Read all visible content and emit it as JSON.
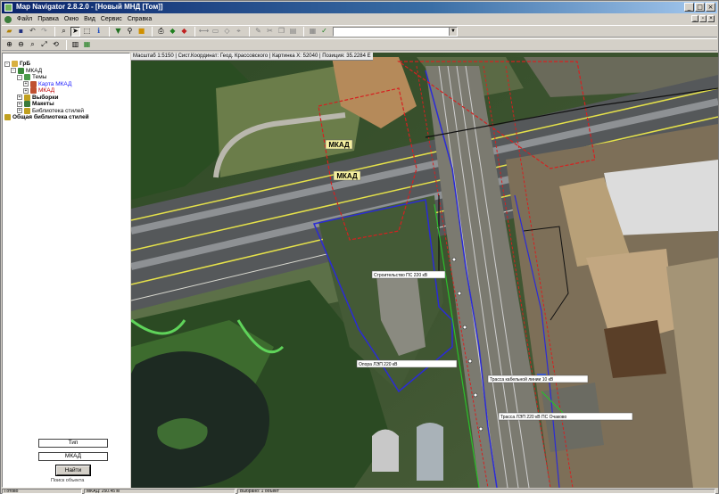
{
  "window": {
    "title": "Map Navigator 2.8.2.0 - [Новый МНД [Том]]",
    "controls": {
      "minimize": "_",
      "maximize": "□",
      "close": "×"
    }
  },
  "menu": {
    "items": [
      "Файл",
      "Правка",
      "Окно",
      "Вид",
      "Сервис",
      "Справка"
    ]
  },
  "toolbar": {
    "search_value": ""
  },
  "tree": {
    "items": [
      {
        "label": "ГрБ",
        "level": 0,
        "expander": "-",
        "icon": "folder-icon",
        "color": "#000000"
      },
      {
        "label": "МКАД",
        "level": 1,
        "expander": "-",
        "icon": "globe-icon",
        "color": "#000000"
      },
      {
        "label": "Темы",
        "level": 2,
        "expander": "-",
        "icon": "layers-icon",
        "color": "#000000"
      },
      {
        "label": "Карта МКАД",
        "level": 3,
        "expander": "+",
        "icon": "map-icon",
        "color": "#1a1aff"
      },
      {
        "label": "МКАД",
        "level": 3,
        "expander": "+",
        "icon": "map-icon",
        "color": "#c00000"
      },
      {
        "label": "Выборки",
        "level": 2,
        "expander": "+",
        "icon": "filter-icon",
        "color": "#000000"
      },
      {
        "label": "Макеты",
        "level": 2,
        "expander": "+",
        "icon": "layout-icon",
        "color": "#000000"
      },
      {
        "label": "Библиотека стилей",
        "level": 2,
        "expander": "+",
        "icon": "library-icon",
        "color": "#000000"
      },
      {
        "label": "Общая библиотека стилей",
        "level": 0,
        "expander": "",
        "icon": "library-icon",
        "color": "#000000"
      }
    ]
  },
  "left_panel": {
    "field1": "Тип",
    "field2": "МКАД",
    "button": "Найти",
    "caption": "Поиск объекта"
  },
  "map": {
    "info": "Масштаб 1:5150 | Сист.Координат: Геод. Крассовского | Картинка X: 52040 | Позиция: 35.2284 E",
    "road_labels": [
      "МКАД",
      "МКАД"
    ],
    "callouts": [
      "Строительство ПС 220 кВ",
      "Опора ЛЭП 220 кВ",
      "Трасса кабельной линии 10 кВ",
      "Трасса ЛЭП 220 кВ ПС Очаково"
    ]
  },
  "status": {
    "cells": [
      "Готово",
      "МКАД: 250.45 м",
      "Выбрано: 1 объект"
    ]
  }
}
